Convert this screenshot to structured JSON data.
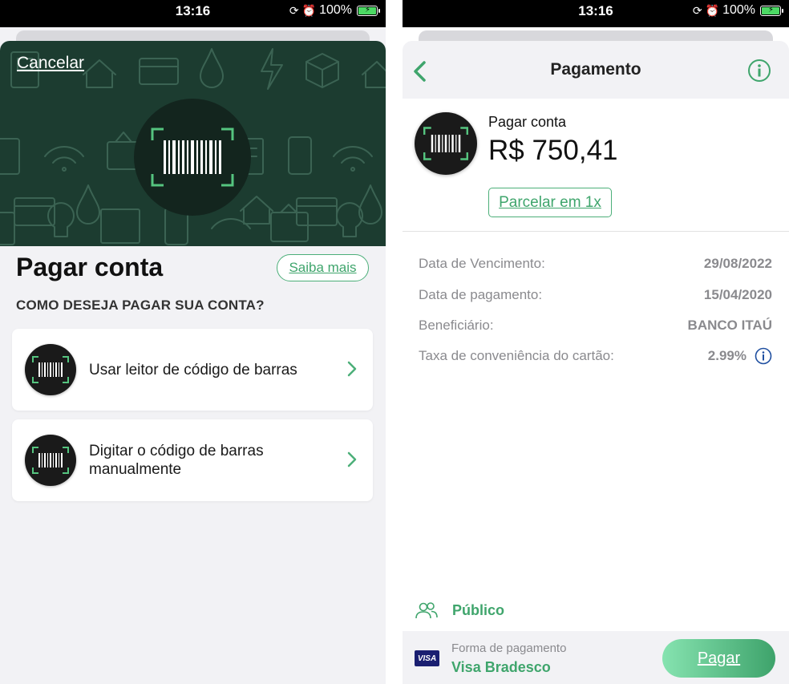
{
  "status_bar": {
    "time": "13:16",
    "battery": "100%"
  },
  "left_screen": {
    "cancel_label": "Cancelar",
    "title": "Pagar conta",
    "saiba_mais_label": "Saiba mais",
    "subtitle": "COMO DESEJA PAGAR SUA CONTA?",
    "options": [
      {
        "label": "Usar leitor de código de barras"
      },
      {
        "label": "Digitar o código de barras manualmente"
      }
    ]
  },
  "right_screen": {
    "header_title": "Pagamento",
    "pay_label": "Pagar conta",
    "amount": "R$ 750,41",
    "parcelar_label": "Parcelar em 1x",
    "details": [
      {
        "key": "Data de Vencimento:",
        "value": "29/08/2022"
      },
      {
        "key": "Data de pagamento:",
        "value": "15/04/2020"
      },
      {
        "key": "Beneficiário:",
        "value": "BANCO ITAÚ"
      },
      {
        "key": "Taxa de conveniência do cartão:",
        "value": "2.99%"
      }
    ],
    "visibility_label": "Público",
    "payment_method_label": "Forma de pagamento",
    "payment_method_value": "Visa Bradesco",
    "card_brand": "VISA",
    "pay_button_label": "Pagar"
  },
  "colors": {
    "accent_green": "#3fa56c",
    "hero_bg": "#1c3c30",
    "icon_dark": "#1a1a1a",
    "visa_blue": "#1a1f71"
  },
  "icons": [
    "alarm-icon",
    "orientation-lock-icon",
    "battery-icon",
    "barcode-scan-icon",
    "chevron-right-icon",
    "back-arrow-icon",
    "info-icon",
    "users-icon"
  ]
}
